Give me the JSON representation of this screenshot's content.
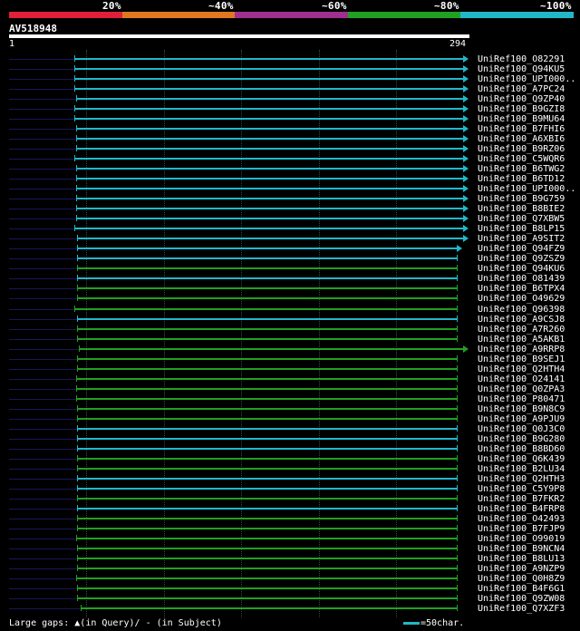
{
  "legend": {
    "labels": [
      "20%",
      "~40%",
      "~60%",
      "~80%",
      "~100%"
    ],
    "colors": [
      "#e0203a",
      "#e07820",
      "#a03090",
      "#21a021",
      "#20b8c8"
    ]
  },
  "query": {
    "name": "AV518948",
    "start": "1",
    "end": "294"
  },
  "footer": {
    "large_gaps_prefix": "Large gaps:",
    "in_query_icon": "caret-up-icon",
    "in_query": "(in Query)/",
    "in_subject": "- (in Subject)",
    "scale_label": "=50char.",
    "scale_color": "#20b8c8"
  },
  "hits": [
    {
      "label": "UniRef100_O82291",
      "color": "#20b8c8",
      "q_start": 43,
      "q_end": 294,
      "arrow": true
    },
    {
      "label": "UniRef100_Q94KU5",
      "color": "#20b8c8",
      "q_start": 43,
      "q_end": 294,
      "arrow": true
    },
    {
      "label": "UniRef100_UPI000..",
      "color": "#20b8c8",
      "q_start": 43,
      "q_end": 294,
      "arrow": true
    },
    {
      "label": "UniRef100_A7PC24",
      "color": "#20b8c8",
      "q_start": 43,
      "q_end": 294,
      "arrow": true
    },
    {
      "label": "UniRef100_Q9ZP40",
      "color": "#20b8c8",
      "q_start": 44,
      "q_end": 294,
      "arrow": true
    },
    {
      "label": "UniRef100_B9GZI8",
      "color": "#20b8c8",
      "q_start": 43,
      "q_end": 294,
      "arrow": true
    },
    {
      "label": "UniRef100_B9MU64",
      "color": "#20b8c8",
      "q_start": 43,
      "q_end": 294,
      "arrow": true
    },
    {
      "label": "UniRef100_B7FHI6",
      "color": "#20b8c8",
      "q_start": 44,
      "q_end": 294,
      "arrow": true
    },
    {
      "label": "UniRef100_A6XBI6",
      "color": "#20b8c8",
      "q_start": 44,
      "q_end": 294,
      "arrow": true
    },
    {
      "label": "UniRef100_B9RZ06",
      "color": "#20b8c8",
      "q_start": 44,
      "q_end": 294,
      "arrow": true
    },
    {
      "label": "UniRef100_C5WQR6",
      "color": "#20b8c8",
      "q_start": 43,
      "q_end": 294,
      "arrow": true
    },
    {
      "label": "UniRef100_B6TWG2",
      "color": "#20b8c8",
      "q_start": 44,
      "q_end": 294,
      "arrow": true
    },
    {
      "label": "UniRef100_B6TD12",
      "color": "#20b8c8",
      "q_start": 44,
      "q_end": 294,
      "arrow": true
    },
    {
      "label": "UniRef100_UPI000..",
      "color": "#20b8c8",
      "q_start": 44,
      "q_end": 294,
      "arrow": true
    },
    {
      "label": "UniRef100_B9G759",
      "color": "#20b8c8",
      "q_start": 44,
      "q_end": 294,
      "arrow": true
    },
    {
      "label": "UniRef100_B8BIE2",
      "color": "#20b8c8",
      "q_start": 44,
      "q_end": 294,
      "arrow": true
    },
    {
      "label": "UniRef100_Q7XBW5",
      "color": "#20b8c8",
      "q_start": 44,
      "q_end": 294,
      "arrow": true
    },
    {
      "label": "UniRef100_B8LP15",
      "color": "#20b8c8",
      "q_start": 43,
      "q_end": 294,
      "arrow": true
    },
    {
      "label": "UniRef100_A9SIT2",
      "color": "#20b8c8",
      "q_start": 45,
      "q_end": 294,
      "arrow": true
    },
    {
      "label": "UniRef100_Q94FZ9",
      "color": "#20b8c8",
      "q_start": 45,
      "q_end": 290,
      "arrow": true
    },
    {
      "label": "UniRef100_Q9ZSZ9",
      "color": "#20b8c8",
      "q_start": 45,
      "q_end": 290,
      "arrow": false
    },
    {
      "label": "UniRef100_Q94KU6",
      "color": "#21a021",
      "q_start": 45,
      "q_end": 290,
      "arrow": false
    },
    {
      "label": "UniRef100_O81439",
      "color": "#20b8c8",
      "q_start": 45,
      "q_end": 290,
      "arrow": false
    },
    {
      "label": "UniRef100_B6TPX4",
      "color": "#21a021",
      "q_start": 45,
      "q_end": 290,
      "arrow": false
    },
    {
      "label": "UniRef100_O49629",
      "color": "#21a021",
      "q_start": 45,
      "q_end": 290,
      "arrow": false
    },
    {
      "label": "UniRef100_Q96398",
      "color": "#21a021",
      "q_start": 43,
      "q_end": 290,
      "arrow": false
    },
    {
      "label": "UniRef100_A9CSJ8",
      "color": "#20b8c8",
      "q_start": 45,
      "q_end": 290,
      "arrow": false
    },
    {
      "label": "UniRef100_A7R260",
      "color": "#21a021",
      "q_start": 45,
      "q_end": 290,
      "arrow": false
    },
    {
      "label": "UniRef100_A5AKB1",
      "color": "#21a021",
      "q_start": 45,
      "q_end": 290,
      "arrow": false
    },
    {
      "label": "UniRef100_A9RRP8",
      "color": "#21a021",
      "q_start": 46,
      "q_end": 294,
      "arrow": true
    },
    {
      "label": "UniRef100_B9SEJ1",
      "color": "#21a021",
      "q_start": 45,
      "q_end": 290,
      "arrow": false
    },
    {
      "label": "UniRef100_Q2HTH4",
      "color": "#21a021",
      "q_start": 45,
      "q_end": 290,
      "arrow": false
    },
    {
      "label": "UniRef100_O24141",
      "color": "#21a021",
      "q_start": 44,
      "q_end": 290,
      "arrow": false
    },
    {
      "label": "UniRef100_Q0ZPA3",
      "color": "#21a021",
      "q_start": 44,
      "q_end": 290,
      "arrow": false
    },
    {
      "label": "UniRef100_P80471",
      "color": "#21a021",
      "q_start": 44,
      "q_end": 290,
      "arrow": false
    },
    {
      "label": "UniRef100_B9N8C9",
      "color": "#21a021",
      "q_start": 45,
      "q_end": 290,
      "arrow": false
    },
    {
      "label": "UniRef100_A9PJU9",
      "color": "#21a021",
      "q_start": 45,
      "q_end": 290,
      "arrow": false
    },
    {
      "label": "UniRef100_Q0J3C0",
      "color": "#20b8c8",
      "q_start": 45,
      "q_end": 290,
      "arrow": false
    },
    {
      "label": "UniRef100_B9G280",
      "color": "#20b8c8",
      "q_start": 45,
      "q_end": 290,
      "arrow": false
    },
    {
      "label": "UniRef100_B8BD60",
      "color": "#20b8c8",
      "q_start": 45,
      "q_end": 290,
      "arrow": false
    },
    {
      "label": "UniRef100_Q6K439",
      "color": "#21a021",
      "q_start": 45,
      "q_end": 290,
      "arrow": false
    },
    {
      "label": "UniRef100_B2LU34",
      "color": "#21a021",
      "q_start": 45,
      "q_end": 290,
      "arrow": false
    },
    {
      "label": "UniRef100_Q2HTH3",
      "color": "#20b8c8",
      "q_start": 45,
      "q_end": 290,
      "arrow": false
    },
    {
      "label": "UniRef100_C5Y9P8",
      "color": "#20b8c8",
      "q_start": 45,
      "q_end": 290,
      "arrow": false
    },
    {
      "label": "UniRef100_B7FKR2",
      "color": "#21a021",
      "q_start": 45,
      "q_end": 290,
      "arrow": false
    },
    {
      "label": "UniRef100_B4FRP8",
      "color": "#20b8c8",
      "q_start": 45,
      "q_end": 290,
      "arrow": false
    },
    {
      "label": "UniRef100_O42493",
      "color": "#21a021",
      "q_start": 45,
      "q_end": 290,
      "arrow": false
    },
    {
      "label": "UniRef100_B7FJP9",
      "color": "#21a021",
      "q_start": 45,
      "q_end": 290,
      "arrow": false
    },
    {
      "label": "UniRef100_O99019",
      "color": "#21a021",
      "q_start": 44,
      "q_end": 290,
      "arrow": false
    },
    {
      "label": "UniRef100_B9NCN4",
      "color": "#21a021",
      "q_start": 45,
      "q_end": 290,
      "arrow": false
    },
    {
      "label": "UniRef100_B8LU13",
      "color": "#21a021",
      "q_start": 45,
      "q_end": 290,
      "arrow": false
    },
    {
      "label": "UniRef100_A9NZP9",
      "color": "#21a021",
      "q_start": 45,
      "q_end": 290,
      "arrow": false
    },
    {
      "label": "UniRef100_Q0H8Z9",
      "color": "#21a021",
      "q_start": 44,
      "q_end": 290,
      "arrow": false
    },
    {
      "label": "UniRef100_B4F6G1",
      "color": "#21a021",
      "q_start": 45,
      "q_end": 290,
      "arrow": false
    },
    {
      "label": "UniRef100_Q9ZW08",
      "color": "#21a021",
      "q_start": 45,
      "q_end": 290,
      "arrow": false
    },
    {
      "label": "UniRef100_Q7XZF3",
      "color": "#21a021",
      "q_start": 47,
      "q_end": 290,
      "arrow": false
    }
  ]
}
